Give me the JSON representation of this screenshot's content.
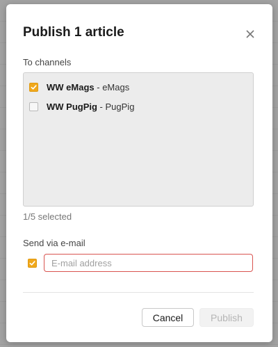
{
  "dialog": {
    "title": "Publish 1 article",
    "close_icon": "close-icon"
  },
  "channels": {
    "label": "To channels",
    "items": [
      {
        "name": "WW eMags",
        "separator": " - ",
        "detail": "eMags",
        "checked": true
      },
      {
        "name": "WW PugPig",
        "separator": " - ",
        "detail": "PugPig",
        "checked": false
      }
    ],
    "selected_count": "1/5 selected"
  },
  "email": {
    "label": "Send via e-mail",
    "checked": true,
    "placeholder": "E-mail address",
    "value": ""
  },
  "buttons": {
    "cancel_label": "Cancel",
    "publish_label": "Publish"
  },
  "colors": {
    "accent_checkbox": "#f0a81c",
    "error_border": "#d9534f"
  }
}
